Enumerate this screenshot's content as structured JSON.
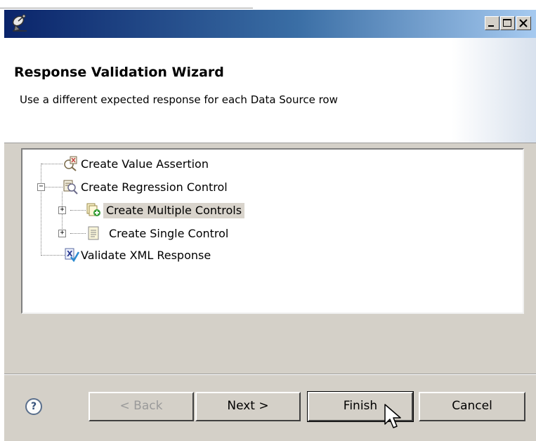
{
  "window": {
    "icon": "satellite-dish-icon",
    "controls": [
      "minimize-icon",
      "maximize-icon",
      "close-icon"
    ]
  },
  "header": {
    "title": "Response Validation Wizard",
    "description": "Use a different expected response for each Data Source row"
  },
  "tree": {
    "nodes": [
      {
        "label": "Create Value Assertion",
        "icon": "value-assertion-icon",
        "expander": ""
      },
      {
        "label": "Create Regression Control",
        "icon": "regression-control-icon",
        "expander": "−"
      },
      {
        "label": "Create Multiple Controls",
        "icon": "multiple-controls-icon",
        "expander": "+"
      },
      {
        "label": "Create Single Control",
        "icon": "single-control-icon",
        "expander": "+"
      },
      {
        "label": "Validate XML Response",
        "icon": "xml-validate-icon",
        "expander": ""
      }
    ]
  },
  "buttons": {
    "help": "?",
    "back": "< Back",
    "next": "Next >",
    "finish": "Finish",
    "cancel": "Cancel"
  },
  "colors": {
    "titlebar_start": "#0a246a",
    "titlebar_end": "#a6caf0",
    "dialog_bg": "#d4d0c8",
    "selection_bg": "#d9d4cc"
  }
}
